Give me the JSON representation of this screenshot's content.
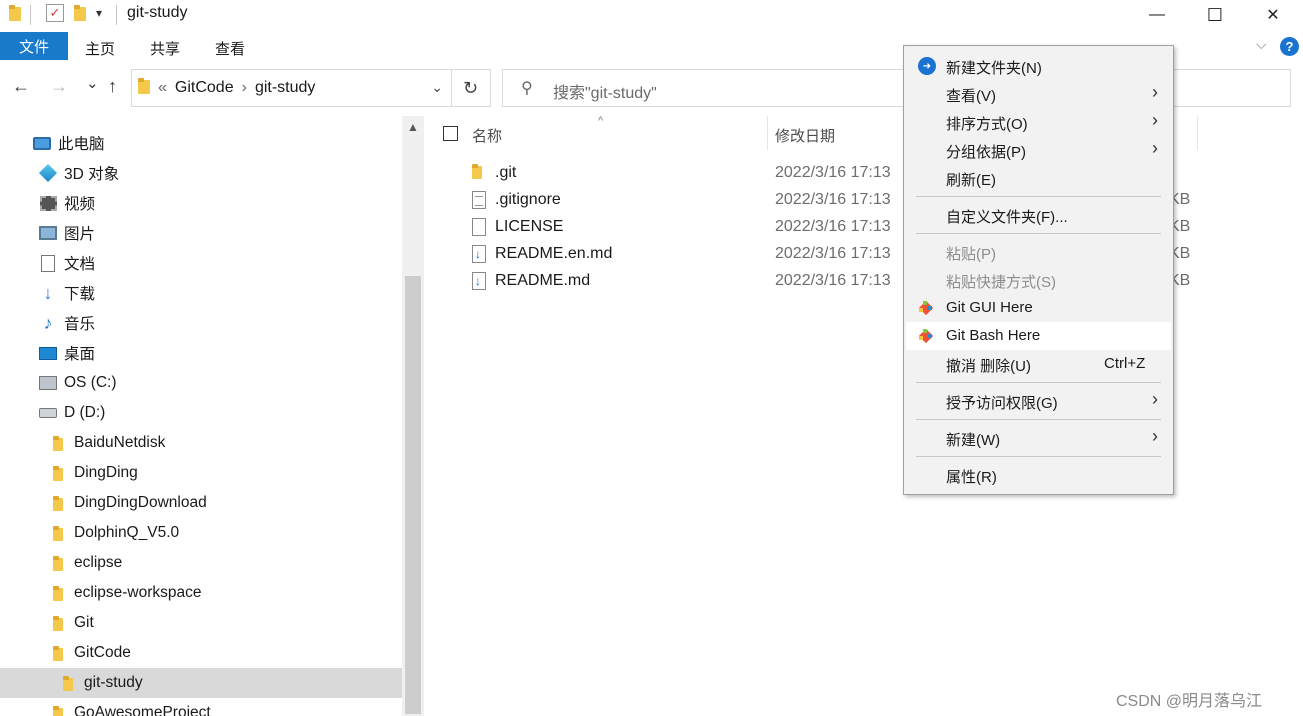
{
  "window": {
    "title": "git-study",
    "minimize_glyph": "—",
    "maximize_glyph": "☐",
    "close_glyph": "✕"
  },
  "ribbon": {
    "tabs": [
      "文件",
      "主页",
      "共享",
      "查看"
    ],
    "help_glyph": "?",
    "expand_glyph": "⌵"
  },
  "nav": {
    "back_glyph": "←",
    "forward_glyph": "→",
    "recent_glyph": "⌄",
    "up_glyph": "↑",
    "breadcrumb": [
      "«",
      "GitCode",
      "›",
      "git-study"
    ],
    "dropdown_glyph": "⌄",
    "refresh_glyph": "↻"
  },
  "search": {
    "placeholder": "搜索\"git-study\"",
    "icon": "search-icon"
  },
  "sidebar": {
    "scroll_up_glyph": "▲",
    "items": [
      {
        "label": "此电脑",
        "icon": "this-pc-icon",
        "indent": 0
      },
      {
        "label": "3D 对象",
        "icon": "3d-objects-icon",
        "indent": 1
      },
      {
        "label": "视频",
        "icon": "videos-icon",
        "indent": 1
      },
      {
        "label": "图片",
        "icon": "pictures-icon",
        "indent": 1
      },
      {
        "label": "文档",
        "icon": "documents-icon",
        "indent": 1
      },
      {
        "label": "下载",
        "icon": "downloads-icon",
        "indent": 1
      },
      {
        "label": "音乐",
        "icon": "music-icon",
        "indent": 1
      },
      {
        "label": "桌面",
        "icon": "desktop-icon",
        "indent": 1
      },
      {
        "label": "OS (C:)",
        "icon": "os-drive-icon",
        "indent": 1
      },
      {
        "label": "D (D:)",
        "icon": "drive-icon",
        "indent": 1
      },
      {
        "label": "BaiduNetdisk",
        "icon": "folder-icon",
        "indent": 2
      },
      {
        "label": "DingDing",
        "icon": "folder-icon",
        "indent": 2
      },
      {
        "label": "DingDingDownload",
        "icon": "folder-icon",
        "indent": 2
      },
      {
        "label": "DolphinQ_V5.0",
        "icon": "folder-icon",
        "indent": 2
      },
      {
        "label": "eclipse",
        "icon": "folder-icon",
        "indent": 2
      },
      {
        "label": "eclipse-workspace",
        "icon": "folder-icon",
        "indent": 2
      },
      {
        "label": "Git",
        "icon": "folder-icon",
        "indent": 2
      },
      {
        "label": "GitCode",
        "icon": "folder-icon",
        "indent": 2
      },
      {
        "label": "git-study",
        "icon": "folder-icon",
        "indent": 3,
        "selected": true
      },
      {
        "label": "GoAwesomeProject",
        "icon": "folder-icon",
        "indent": 2
      }
    ]
  },
  "filelist": {
    "columns": {
      "name": "名称",
      "date": "修改日期",
      "sort_glyph": "^"
    },
    "files": [
      {
        "name": ".git",
        "date": "2022/3/16 17:13",
        "size": "",
        "icon": "folder-icon"
      },
      {
        "name": ".gitignore",
        "date": "2022/3/16 17:13",
        "size": "KB",
        "icon": "text-file-icon"
      },
      {
        "name": "LICENSE",
        "date": "2022/3/16 17:13",
        "size": "KB",
        "icon": "file-icon"
      },
      {
        "name": "README.en.md",
        "date": "2022/3/16 17:13",
        "size": "KB",
        "icon": "markdown-file-icon"
      },
      {
        "name": "README.md",
        "date": "2022/3/16 17:13",
        "size": "KB",
        "icon": "markdown-file-icon"
      }
    ]
  },
  "context_menu": {
    "items": [
      {
        "label": "新建文件夹(N)",
        "icon": "pin-icon",
        "submenu": false
      },
      {
        "label": "查看(V)",
        "submenu": true
      },
      {
        "label": "排序方式(O)",
        "submenu": true
      },
      {
        "label": "分组依据(P)",
        "submenu": true
      },
      {
        "label": "刷新(E)",
        "submenu": false
      },
      {
        "separator": true
      },
      {
        "label": "自定义文件夹(F)...",
        "submenu": false
      },
      {
        "separator": true
      },
      {
        "label": "粘贴(P)",
        "disabled": true
      },
      {
        "label": "粘贴快捷方式(S)",
        "disabled": true
      },
      {
        "label": "Git GUI Here",
        "icon": "git-gui-icon"
      },
      {
        "label": "Git Bash Here",
        "icon": "git-bash-icon",
        "hover": true
      },
      {
        "label": "撤消 删除(U)",
        "shortcut": "Ctrl+Z"
      },
      {
        "separator": true
      },
      {
        "label": "授予访问权限(G)",
        "submenu": true
      },
      {
        "separator": true
      },
      {
        "label": "新建(W)",
        "submenu": true
      },
      {
        "separator": true
      },
      {
        "label": "属性(R)"
      }
    ],
    "arrow_glyph": "›"
  },
  "watermark": "CSDN @明月落乌江",
  "colors": {
    "accent": "#1979ca",
    "selection": "#d9d9d9",
    "folder": "#f4c84a",
    "menu_bg": "#f2f2f2"
  }
}
